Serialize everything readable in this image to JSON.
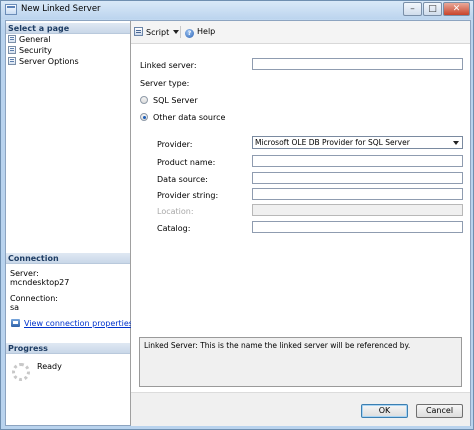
{
  "window": {
    "title": "New Linked Server"
  },
  "left": {
    "select_page_header": "Select a page",
    "pages": [
      "General",
      "Security",
      "Server Options"
    ],
    "connection_header": "Connection",
    "server_label": "Server:",
    "server_value": "mcndesktop27",
    "connection_label": "Connection:",
    "connection_value": "sa",
    "view_connection_link": "View connection properties",
    "progress_header": "Progress",
    "progress_status": "Ready"
  },
  "toolbar": {
    "script_label": "Script",
    "help_label": "Help"
  },
  "form": {
    "linked_server_label": "Linked server:",
    "linked_server_value": "",
    "server_type_label": "Server type:",
    "sql_server_option": "SQL Server",
    "other_source_option": "Other data source",
    "selected_server_type": "Other data source",
    "provider_label": "Provider:",
    "provider_value": "Microsoft OLE DB Provider for SQL Server",
    "product_name_label": "Product name:",
    "product_name_value": "",
    "data_source_label": "Data source:",
    "data_source_value": "",
    "provider_string_label": "Provider string:",
    "provider_string_value": "",
    "location_label": "Location:",
    "location_value": "",
    "catalog_label": "Catalog:",
    "catalog_value": ""
  },
  "description": {
    "text": "Linked Server: This is the name the linked server will be referenced by."
  },
  "footer": {
    "ok_label": "OK",
    "cancel_label": "Cancel"
  },
  "icons": {
    "title": "window-icon",
    "pages": "page-icon",
    "link": "connection-properties-icon",
    "script": "script-icon",
    "help": "help-icon",
    "progress": "spinner-icon"
  },
  "colors": {
    "link": "#0033cc",
    "radio_selected": "#1a5cb6",
    "section_header_text": "#1e3d64"
  }
}
